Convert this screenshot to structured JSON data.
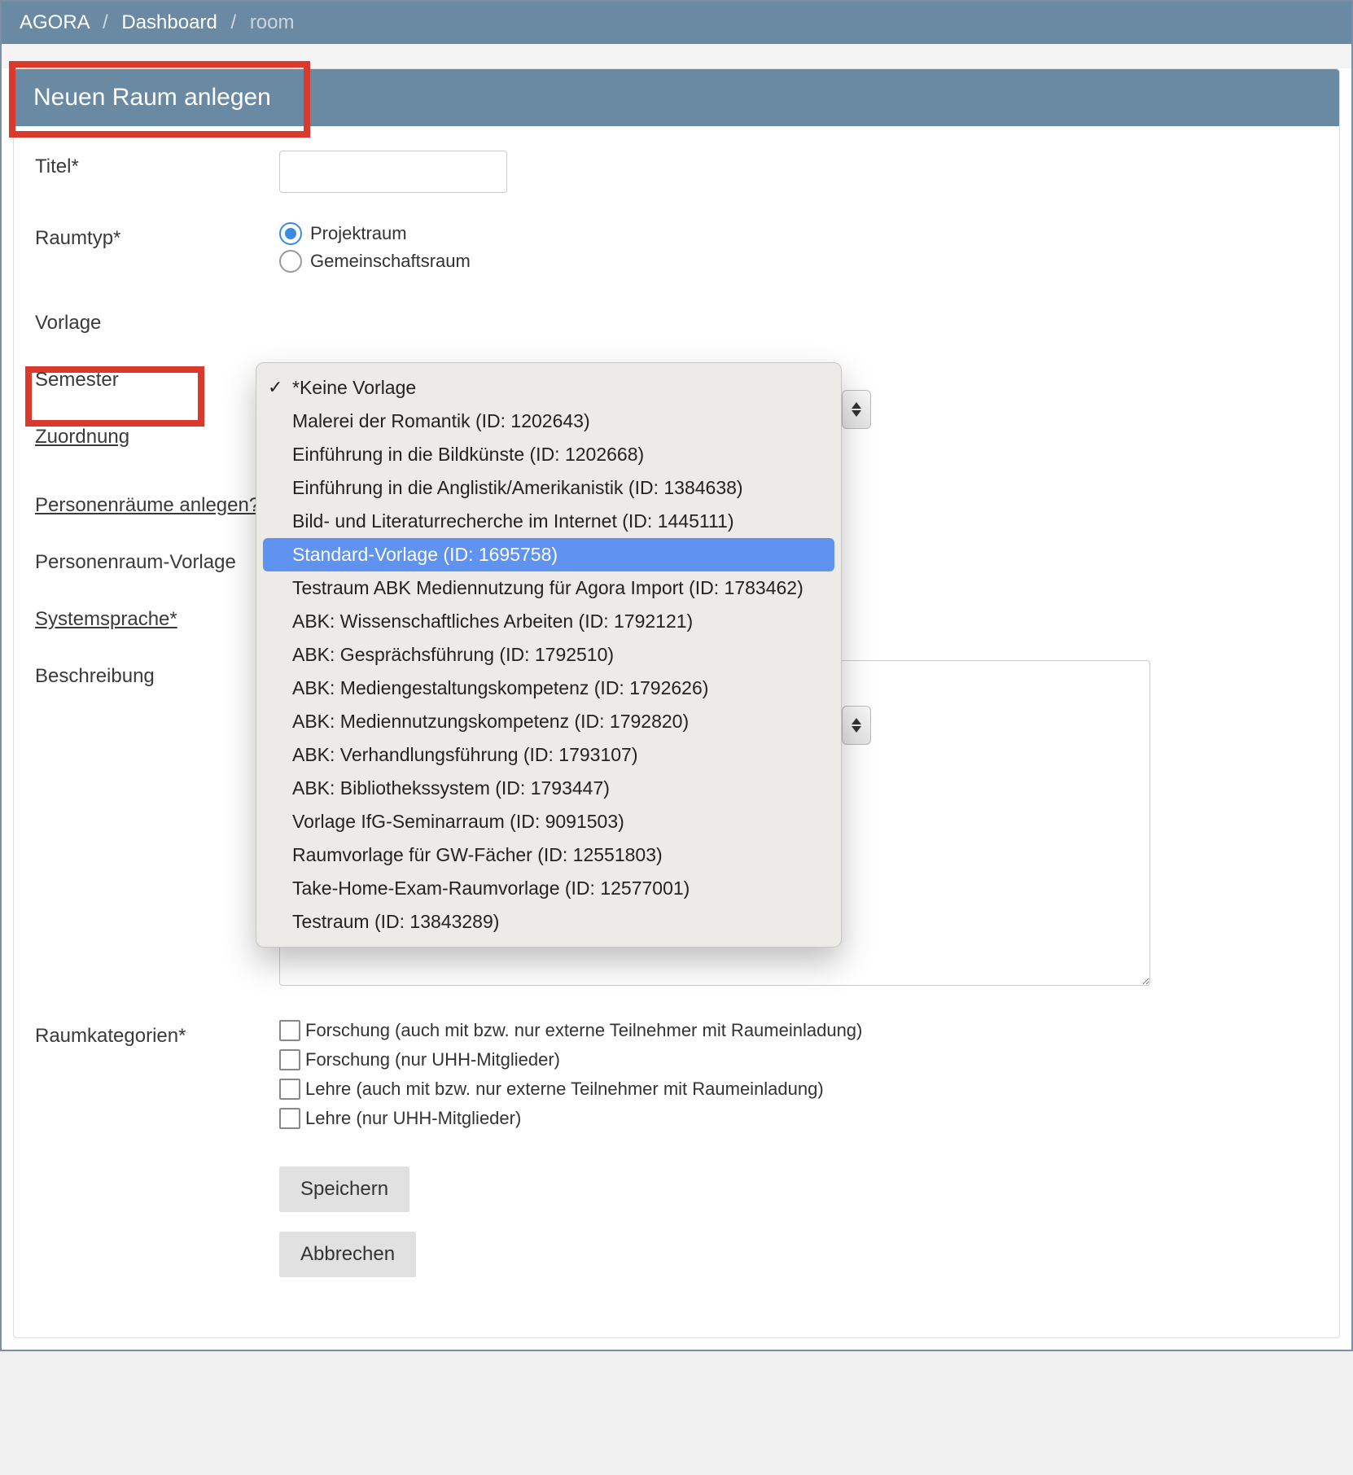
{
  "breadcrumb": {
    "root": "AGORA",
    "dash": "Dashboard",
    "current": "room"
  },
  "header": {
    "title": "Neuen Raum anlegen"
  },
  "labels": {
    "titel": "Titel*",
    "raumtyp": "Raumtyp*",
    "vorlage": "Vorlage",
    "semester": "Semester",
    "zuordnung": "Zuordnung",
    "personenraeume": "Personenräume anlegen?",
    "personenraum_vorlage": "Personenraum-Vorlage",
    "systemsprache": "Systemsprache*",
    "beschreibung": "Beschreibung",
    "raumkategorien": "Raumkategorien*"
  },
  "raumtyp": {
    "opt1": "Projektraum",
    "opt2": "Gemeinschaftsraum",
    "selected": "Projektraum"
  },
  "vorlage_dropdown": {
    "selected": "*Keine Vorlage",
    "highlighted": "Standard-Vorlage (ID: 1695758)",
    "options": [
      "*Keine Vorlage",
      "Malerei der Romantik (ID: 1202643)",
      "Einführung in die Bildkünste (ID: 1202668)",
      "Einführung in die Anglistik/Amerikanistik (ID: 1384638)",
      "Bild- und Literaturrecherche im Internet (ID: 1445111)",
      "Standard-Vorlage (ID: 1695758)",
      "Testraum ABK Mediennutzung für Agora Import (ID: 1783462)",
      "ABK: Wissenschaftliches Arbeiten (ID: 1792121)",
      "ABK: Gesprächsführung (ID: 1792510)",
      "ABK: Mediengestaltungskompetenz (ID: 1792626)",
      "ABK: Mediennutzungskompetenz (ID: 1792820)",
      "ABK: Verhandlungsführung (ID: 1793107)",
      "ABK: Bibliothekssystem (ID: 1793447)",
      "Vorlage IfG-Seminarraum (ID: 9091503)",
      "Raumvorlage für GW-Fächer (ID: 12551803)",
      "Take-Home-Exam-Raumvorlage (ID: 12577001)",
      "Testraum (ID: 13843289)"
    ]
  },
  "raumkategorien": [
    "Forschung (auch mit bzw. nur externe Teilnehmer mit Raumeinladung)",
    "Forschung (nur UHH-Mitglieder)",
    "Lehre (auch mit bzw. nur externe Teilnehmer mit Raumeinladung)",
    "Lehre (nur UHH-Mitglieder)"
  ],
  "buttons": {
    "save": "Speichern",
    "cancel": "Abbrechen"
  },
  "colors": {
    "header_bg": "#6a89a3",
    "highlight_border": "#d93a2b",
    "dropdown_highlight": "#5f93ef"
  }
}
